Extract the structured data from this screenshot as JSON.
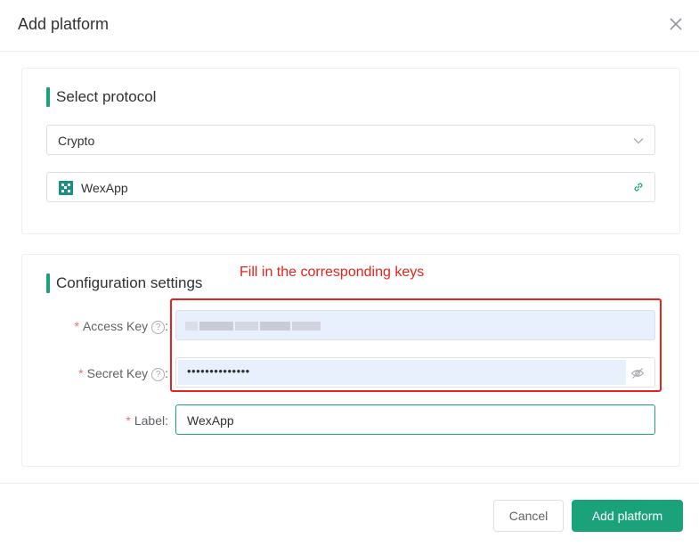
{
  "dialog": {
    "title": "Add platform"
  },
  "protocol_section": {
    "title": "Select protocol",
    "protocol_select": {
      "value": "Crypto"
    },
    "platform": {
      "name": "WexApp",
      "logo_text": "W EX"
    }
  },
  "config_section": {
    "title": "Configuration settings",
    "annotation": "Fill in the corresponding keys",
    "access_key": {
      "label": "Access Key",
      "required_mark": "*",
      "help": "?"
    },
    "secret_key": {
      "label": "Secret Key",
      "required_mark": "*",
      "help": "?",
      "value_masked": "••••••••••••••"
    },
    "label_field": {
      "label": "Label",
      "required_mark": "*",
      "value": "WexApp"
    }
  },
  "footer": {
    "cancel_label": "Cancel",
    "add_label": "Add platform"
  },
  "colors": {
    "accent": "#1aa37a",
    "annotation_red": "#e8221c",
    "required": "#f56c6c",
    "autofill_bg": "#e8f0fe"
  }
}
